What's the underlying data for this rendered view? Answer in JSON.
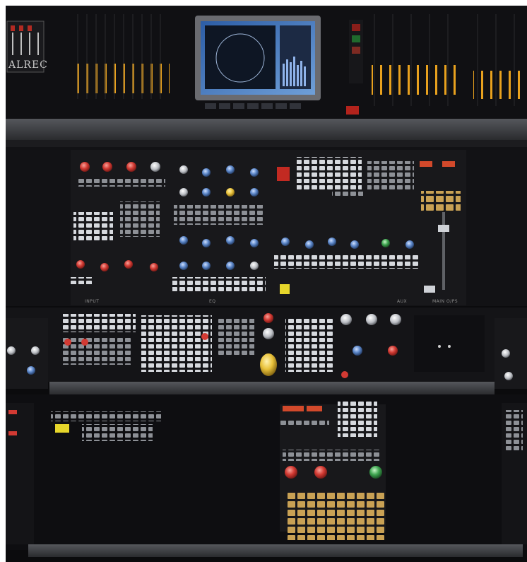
{
  "brand": "ALREC",
  "section_labels": {
    "input": "INPUT",
    "eq": "EQ",
    "main_outs": "MAIN O/PS",
    "aux": "AUX"
  },
  "colors": {
    "chassis": "#0d0d0f",
    "panel": "#1b1b1e",
    "rail": "#3a3b3f",
    "meter_amber": "#e8a11e",
    "monitor_screen": "#3b6fb6",
    "key_white": "#d9dde2",
    "knob_red": "#d23a33",
    "knob_yellow": "#e9c23b",
    "knob_blue": "#5b86c8"
  }
}
